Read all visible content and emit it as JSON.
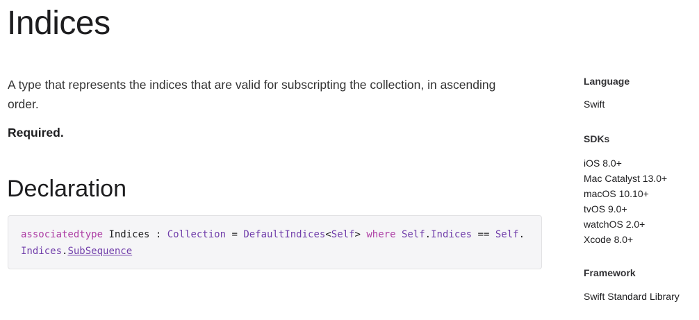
{
  "page": {
    "title": "Indices",
    "abstract": "A type that represents the indices that are valid for subscripting the collection, in ascending order.",
    "required": "Required."
  },
  "declaration": {
    "heading": "Declaration",
    "tokens": {
      "t1": "associatedtype",
      "t2": " Indices : ",
      "t3": "Collection",
      "t4": " = ",
      "t5": "DefaultIndices",
      "t6": "<",
      "t7": "Self",
      "t8": "> ",
      "t9": "where",
      "t10": " ",
      "t11": "Self",
      "t12": ".",
      "t13": "Indices",
      "t14": " == ",
      "t15": "Self",
      "t16": ".",
      "t17": "Indices",
      "t18": ".",
      "t19": "SubSequence"
    }
  },
  "sidebar": {
    "language_heading": "Language",
    "language_value": "Swift",
    "sdks_heading": "SDKs",
    "sdks": [
      "iOS 8.0+",
      "Mac Catalyst 13.0+",
      "macOS 10.10+",
      "tvOS 9.0+",
      "watchOS 2.0+",
      "Xcode 8.0+"
    ],
    "framework_heading": "Framework",
    "framework_value": "Swift Standard Library"
  },
  "colors": {
    "keyword": "#ad3da4",
    "type": "#703daa",
    "text": "#1d1d1f",
    "code_background": "#f5f5f7"
  }
}
